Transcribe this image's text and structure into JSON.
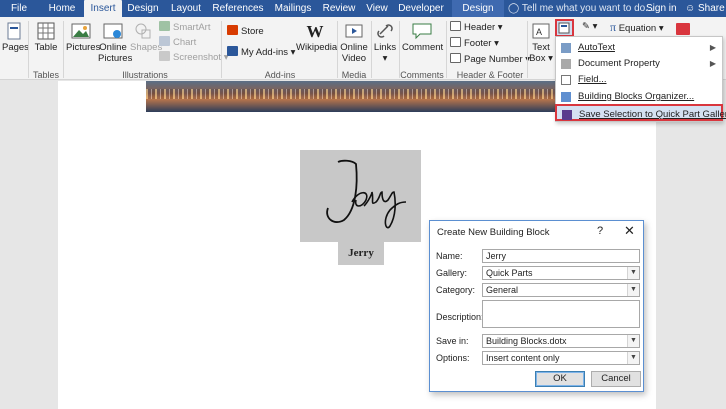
{
  "tabs": [
    "File",
    "Home",
    "Insert",
    "Design",
    "Layout",
    "References",
    "Mailings",
    "Review",
    "View",
    "Developer",
    "Design"
  ],
  "active_tab": "Insert",
  "tell_me": "Tell me what you want to do...",
  "sign_in": "Sign in",
  "share": "Share",
  "ribbon": {
    "pages": "Pages",
    "table": "Table",
    "pictures": "Pictures",
    "online_pictures": "Online Pictures",
    "shapes": "Shapes",
    "smartart": "SmartArt",
    "chart": "Chart",
    "screenshot": "Screenshot",
    "store": "Store",
    "my_addins": "My Add-ins",
    "wikipedia": "Wikipedia",
    "online_video": "Online Video",
    "links": "Links",
    "comment": "Comment",
    "header": "Header",
    "footer": "Footer",
    "page_number": "Page Number",
    "text_box": "Text Box",
    "equation": "Equation",
    "groups": {
      "tables": "Tables",
      "illustrations": "Illustrations",
      "addins": "Add-ins",
      "media": "Media",
      "comments": "Comments",
      "header_footer": "Header & Footer"
    }
  },
  "quick_parts_menu": {
    "items": [
      "AutoText",
      "Document Property",
      "Field...",
      "Building Blocks Organizer...",
      "Save Selection to Quick Part Gallery..."
    ]
  },
  "document": {
    "signature_text": "Jerry",
    "name_label": "Jerry"
  },
  "dialog": {
    "title": "Create New Building Block",
    "help": "?",
    "close": "✕",
    "name_label": "Name:",
    "name_value": "Jerry",
    "gallery_label": "Gallery:",
    "gallery_value": "Quick Parts",
    "category_label": "Category:",
    "category_value": "General",
    "description_label": "Description:",
    "description_value": "",
    "save_in_label": "Save in:",
    "save_in_value": "Building Blocks.dotx",
    "options_label": "Options:",
    "options_value": "Insert content only",
    "ok": "OK",
    "cancel": "Cancel"
  }
}
